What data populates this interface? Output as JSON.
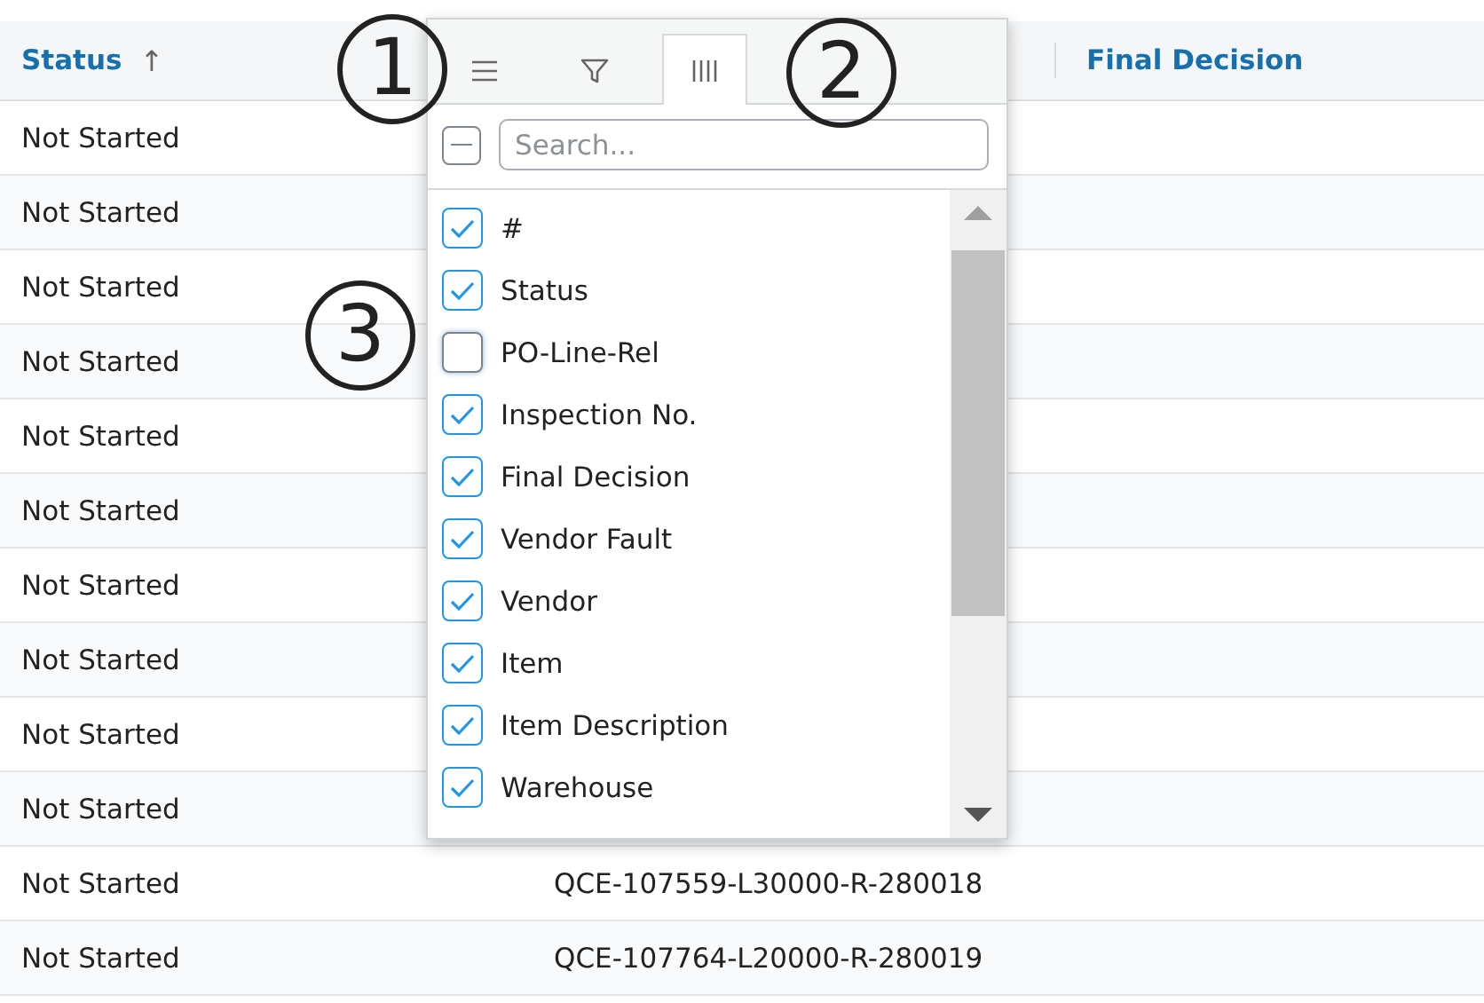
{
  "table": {
    "columns": [
      {
        "label": "Status",
        "sort_icon": "↑"
      },
      {
        "label": "Final Decision"
      }
    ],
    "rows": [
      {
        "status": "Not Started"
      },
      {
        "status": "Not Started"
      },
      {
        "status": "Not Started"
      },
      {
        "status": "Not Started"
      },
      {
        "status": "Not Started"
      },
      {
        "status": "Not Started"
      },
      {
        "status": "Not Started"
      },
      {
        "status": "Not Started"
      },
      {
        "status": "Not Started"
      },
      {
        "status": "Not Started"
      },
      {
        "status": "Not Started",
        "column_2": "QCE-107559-L30000-R-280018"
      },
      {
        "status": "Not Started",
        "column_2": "QCE-107764-L20000-R-280019"
      }
    ]
  },
  "column_menu": {
    "tabs": [
      {
        "kind": "menu",
        "selected": false
      },
      {
        "kind": "filter",
        "selected": false
      },
      {
        "kind": "columns",
        "selected": true
      }
    ],
    "select_all": {
      "indeterminate": true
    },
    "search": {
      "placeholder": "Search..."
    },
    "items": [
      {
        "label": "#",
        "checked": true
      },
      {
        "label": "Status",
        "checked": true
      },
      {
        "label": "PO-Line-Rel",
        "checked": false
      },
      {
        "label": "Inspection No.",
        "checked": true
      },
      {
        "label": "Final Decision",
        "checked": true
      },
      {
        "label": "Vendor Fault",
        "checked": true
      },
      {
        "label": "Vendor",
        "checked": true
      },
      {
        "label": "Item",
        "checked": true
      },
      {
        "label": "Item Description",
        "checked": true
      },
      {
        "label": "Warehouse",
        "checked": true
      }
    ]
  },
  "annotations": [
    {
      "label": "1"
    },
    {
      "label": "2"
    },
    {
      "label": "3"
    }
  ]
}
